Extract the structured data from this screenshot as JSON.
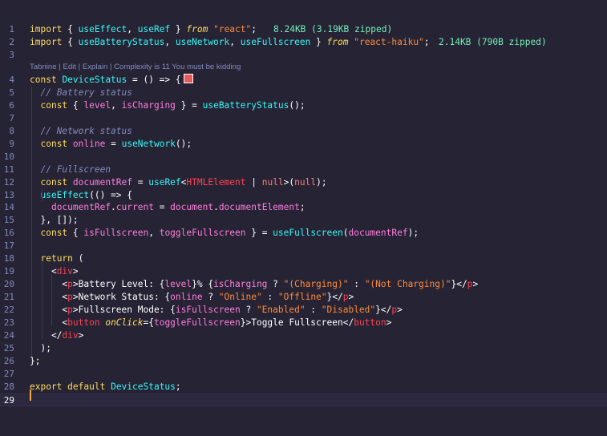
{
  "lines": [
    {
      "n": "1",
      "segs": [
        [
          "import",
          "kw"
        ],
        [
          " { ",
          "white"
        ],
        [
          "useEffect",
          "fn"
        ],
        [
          ", ",
          "white"
        ],
        [
          "useRef",
          "fn"
        ],
        [
          " } ",
          "white"
        ],
        [
          "from",
          "kw ital"
        ],
        [
          " ",
          "white"
        ],
        [
          "\"react\"",
          "str"
        ],
        [
          ";",
          "white"
        ]
      ],
      "size": "8.24KB (3.19KB zipped)"
    },
    {
      "n": "2",
      "segs": [
        [
          "import",
          "kw"
        ],
        [
          " { ",
          "white"
        ],
        [
          "useBatteryStatus",
          "fn"
        ],
        [
          ", ",
          "white"
        ],
        [
          "useNetwork",
          "fn"
        ],
        [
          ", ",
          "white"
        ],
        [
          "useFullscreen",
          "fn"
        ],
        [
          " } ",
          "white"
        ],
        [
          "from",
          "kw ital"
        ],
        [
          " ",
          "white"
        ],
        [
          "\"react-haiku\"",
          "str"
        ],
        [
          ";",
          "white"
        ]
      ],
      "size": "2.14KB (790B zipped)"
    },
    {
      "n": "3",
      "segs": []
    },
    {
      "n": "4",
      "segs": [
        [
          "const",
          "kw"
        ],
        [
          " ",
          "white"
        ],
        [
          "DeviceStatus",
          "fn"
        ],
        [
          " = () => {",
          "white"
        ]
      ],
      "box": true
    },
    {
      "n": "5",
      "segs": [
        [
          "  ",
          "white"
        ],
        [
          "// Battery status",
          "cmt"
        ]
      ]
    },
    {
      "n": "6",
      "segs": [
        [
          "  ",
          "white"
        ],
        [
          "const",
          "kw"
        ],
        [
          " { ",
          "white"
        ],
        [
          "level",
          "var"
        ],
        [
          ", ",
          "white"
        ],
        [
          "isCharging",
          "var"
        ],
        [
          " } = ",
          "white"
        ],
        [
          "useBatteryStatus",
          "fn"
        ],
        [
          "();",
          "white"
        ]
      ]
    },
    {
      "n": "7",
      "segs": []
    },
    {
      "n": "8",
      "segs": [
        [
          "  ",
          "white"
        ],
        [
          "// Network status",
          "cmt"
        ]
      ]
    },
    {
      "n": "9",
      "segs": [
        [
          "  ",
          "white"
        ],
        [
          "const",
          "kw"
        ],
        [
          " ",
          "white"
        ],
        [
          "online",
          "var"
        ],
        [
          " = ",
          "white"
        ],
        [
          "useNetwork",
          "fn"
        ],
        [
          "();",
          "white"
        ]
      ]
    },
    {
      "n": "10",
      "segs": []
    },
    {
      "n": "11",
      "segs": [
        [
          "  ",
          "white"
        ],
        [
          "// Fullscreen",
          "cmt"
        ]
      ]
    },
    {
      "n": "12",
      "segs": [
        [
          "  ",
          "white"
        ],
        [
          "const",
          "kw"
        ],
        [
          " ",
          "white"
        ],
        [
          "documentRef",
          "var"
        ],
        [
          " = ",
          "white"
        ],
        [
          "useRef",
          "fn"
        ],
        [
          "<",
          "white"
        ],
        [
          "HTMLElement",
          "ty"
        ],
        [
          " | ",
          "white"
        ],
        [
          "null",
          "nul"
        ],
        [
          ">(",
          "white"
        ],
        [
          "null",
          "nul"
        ],
        [
          ");",
          "white"
        ]
      ]
    },
    {
      "n": "13",
      "segs": [
        [
          "  ",
          "white"
        ],
        [
          "useEffect",
          "fn"
        ],
        [
          "(() => {",
          "white"
        ]
      ]
    },
    {
      "n": "14",
      "segs": [
        [
          "    ",
          "white"
        ],
        [
          "documentRef",
          "var"
        ],
        [
          ".",
          "white"
        ],
        [
          "current",
          "var"
        ],
        [
          " = ",
          "white"
        ],
        [
          "document",
          "var"
        ],
        [
          ".",
          "white"
        ],
        [
          "documentElement",
          "var"
        ],
        [
          ";",
          "white"
        ]
      ]
    },
    {
      "n": "15",
      "segs": [
        [
          "  }, []);",
          "white"
        ]
      ]
    },
    {
      "n": "16",
      "segs": [
        [
          "  ",
          "white"
        ],
        [
          "const",
          "kw"
        ],
        [
          " { ",
          "white"
        ],
        [
          "isFullscreen",
          "var"
        ],
        [
          ", ",
          "white"
        ],
        [
          "toggleFullscreen",
          "var"
        ],
        [
          " } = ",
          "white"
        ],
        [
          "useFullscreen",
          "fn"
        ],
        [
          "(",
          "white"
        ],
        [
          "documentRef",
          "var"
        ],
        [
          ");",
          "white"
        ]
      ]
    },
    {
      "n": "17",
      "segs": []
    },
    {
      "n": "18",
      "segs": [
        [
          "  ",
          "white"
        ],
        [
          "return",
          "kw"
        ],
        [
          " (",
          "white"
        ]
      ]
    },
    {
      "n": "19",
      "segs": [
        [
          "    <",
          "white"
        ],
        [
          "div",
          "ty"
        ],
        [
          ">",
          "white"
        ]
      ]
    },
    {
      "n": "20",
      "segs": [
        [
          "      <",
          "white"
        ],
        [
          "p",
          "ty"
        ],
        [
          ">Battery Level: {",
          "white"
        ],
        [
          "level",
          "var"
        ],
        [
          "}% {",
          "white"
        ],
        [
          "isCharging",
          "var"
        ],
        [
          " ? ",
          "white"
        ],
        [
          "\"(Charging)\"",
          "str"
        ],
        [
          " : ",
          "white"
        ],
        [
          "\"(Not Charging)\"",
          "str"
        ],
        [
          "}</",
          "white"
        ],
        [
          "p",
          "ty"
        ],
        [
          ">",
          "white"
        ]
      ]
    },
    {
      "n": "21",
      "segs": [
        [
          "      <",
          "white"
        ],
        [
          "p",
          "ty"
        ],
        [
          ">Network Status: {",
          "white"
        ],
        [
          "online",
          "var"
        ],
        [
          " ? ",
          "white"
        ],
        [
          "\"Online\"",
          "str"
        ],
        [
          " : ",
          "white"
        ],
        [
          "\"Offline\"",
          "str"
        ],
        [
          "}</",
          "white"
        ],
        [
          "p",
          "ty"
        ],
        [
          ">",
          "white"
        ]
      ]
    },
    {
      "n": "22",
      "segs": [
        [
          "      <",
          "white"
        ],
        [
          "p",
          "ty"
        ],
        [
          ">Fullscreen Mode: {",
          "white"
        ],
        [
          "isFullscreen",
          "var"
        ],
        [
          " ? ",
          "white"
        ],
        [
          "\"Enabled\"",
          "str"
        ],
        [
          " : ",
          "white"
        ],
        [
          "\"Disabled\"",
          "str"
        ],
        [
          "}</",
          "white"
        ],
        [
          "p",
          "ty"
        ],
        [
          ">",
          "white"
        ]
      ]
    },
    {
      "n": "23",
      "segs": [
        [
          "      <",
          "white"
        ],
        [
          "button",
          "ty"
        ],
        [
          " ",
          "white"
        ],
        [
          "onClick",
          "kw ital"
        ],
        [
          "={",
          "white"
        ],
        [
          "toggleFullscreen",
          "var"
        ],
        [
          "}>Toggle Fullscreen</",
          "white"
        ],
        [
          "button",
          "ty"
        ],
        [
          ">",
          "white"
        ]
      ]
    },
    {
      "n": "24",
      "segs": [
        [
          "    </",
          "white"
        ],
        [
          "div",
          "ty"
        ],
        [
          ">",
          "white"
        ]
      ]
    },
    {
      "n": "25",
      "segs": [
        [
          "  );",
          "white"
        ]
      ]
    },
    {
      "n": "26",
      "segs": [
        [
          "};",
          "white"
        ]
      ]
    },
    {
      "n": "27",
      "segs": []
    },
    {
      "n": "28",
      "segs": [
        [
          "export",
          "kw"
        ],
        [
          " ",
          "white"
        ],
        [
          "default",
          "kw"
        ],
        [
          " ",
          "white"
        ],
        [
          "DeviceStatus",
          "fn"
        ],
        [
          ";",
          "white"
        ]
      ]
    },
    {
      "n": "29",
      "segs": [],
      "current": true
    }
  ],
  "codelens": {
    "tabnine": "Tabnine",
    "edit": "Edit",
    "explain": "Explain",
    "complexity": "Complexity is 11 You must be kidding"
  },
  "colors": {
    "background": "#262335",
    "keyword": "#fede5d",
    "function": "#36f9f6",
    "string": "#ff8b39",
    "comment": "#848bbd",
    "size_hint": "#72f1b8"
  }
}
